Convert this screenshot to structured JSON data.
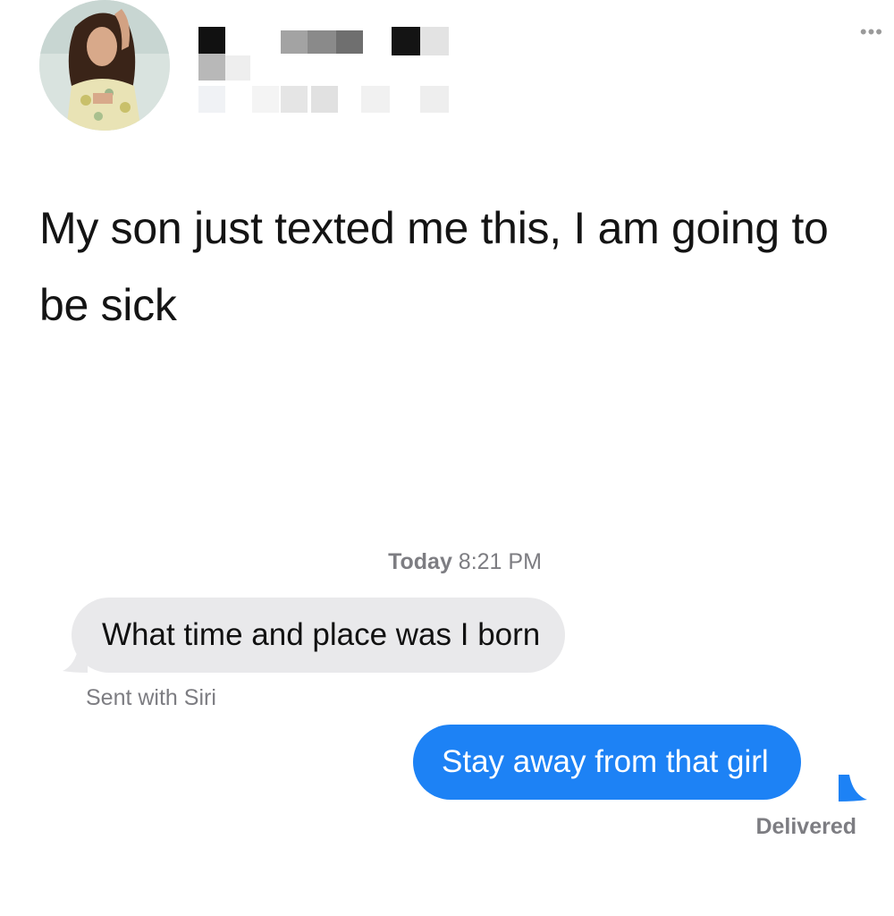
{
  "post": {
    "more_icon": "ellipsis-icon",
    "more_glyph": "•••",
    "text": "My son just texted me this, I am going to be sick"
  },
  "messages": {
    "timestamp_day": "Today",
    "timestamp_time": "8:21 PM",
    "incoming": {
      "text": "What time and place was I born",
      "note": "Sent with Siri",
      "color": "#e9e9eb"
    },
    "outgoing": {
      "text": "Stay away from that girl",
      "status": "Delivered",
      "color": "#1d82f5"
    }
  }
}
